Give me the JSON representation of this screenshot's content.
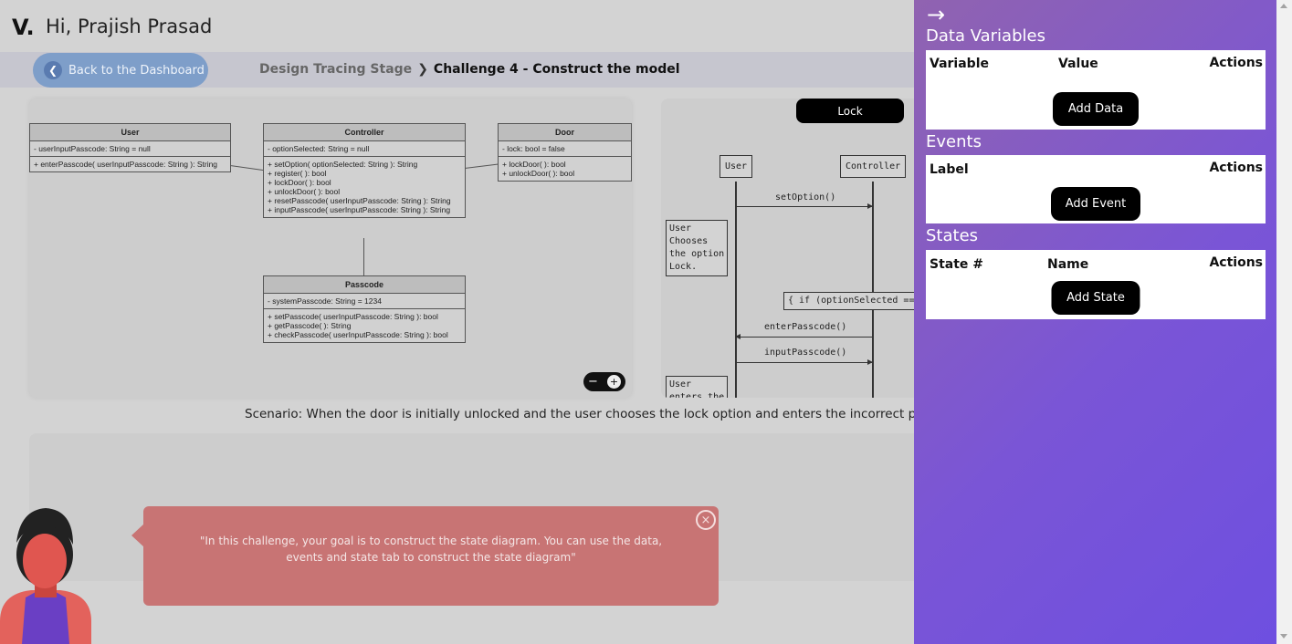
{
  "header": {
    "logo": "V.",
    "greeting": "Hi, Prajish Prasad",
    "back_button": "Back to the Dashboard",
    "breadcrumb_stage": "Design Tracing Stage",
    "breadcrumb_challenge": "Challenge 4 - Construct the model"
  },
  "class_diagram": {
    "user": {
      "name": "User",
      "attributes": [
        "- userInputPasscode: String = null"
      ],
      "methods": [
        "+ enterPasscode( userInputPasscode: String ): String"
      ]
    },
    "controller": {
      "name": "Controller",
      "attributes": [
        "- optionSelected: String = null"
      ],
      "methods": [
        "+ setOption( optionSelected: String ): String",
        "+ register( ): bool",
        "+ lockDoor( ): bool",
        "+ unlockDoor( ): bool",
        "+ resetPasscode( userInputPasscode: String ): String",
        "+ inputPasscode( userInputPasscode: String ): String"
      ]
    },
    "door": {
      "name": "Door",
      "attributes": [
        "- lock: bool = false"
      ],
      "methods": [
        "+ lockDoor( ): bool",
        "+ unlockDoor( ): bool"
      ]
    },
    "passcode": {
      "name": "Passcode",
      "attributes": [
        "- systemPasscode: String = 1234"
      ],
      "methods": [
        "+ setPasscode( userInputPasscode: String ): bool",
        "+ getPasscode( ): String",
        "+ checkPasscode( userInputPasscode: String ): bool"
      ]
    },
    "zoom_out": "−",
    "zoom_in": "+"
  },
  "sequence_diagram": {
    "lock_button": "Lock",
    "lifeline_user": "User",
    "lifeline_controller": "Controller",
    "msg_set_option": "setOption()",
    "note_user_chooses": "User\nChooses\nthe option\nLock.",
    "guard": "{ if (optionSelected == 'lock'",
    "msg_enter_passcode": "enterPasscode()",
    "msg_input_passcode": "inputPasscode()",
    "note_user_enters": "User\nenters the"
  },
  "scenario": "Scenario: When the door is initially unlocked and the user chooses the lock option and enters the incorrect passcode the door remains unlocked.",
  "assistant": {
    "message": "\"In this challenge, your goal is to construct the state diagram. You can use the data, events and state tab to construct the state diagram\"",
    "close": "×"
  },
  "drawer": {
    "arrow": "→",
    "data_variables": {
      "title": "Data Variables",
      "columns": [
        "Variable",
        "Value",
        "Actions"
      ],
      "button": "Add Data"
    },
    "events": {
      "title": "Events",
      "columns": [
        "Label",
        "Actions"
      ],
      "button": "Add Event"
    },
    "states": {
      "title": "States",
      "columns": [
        "State #",
        "Name",
        "Actions"
      ],
      "button": "Add State"
    }
  },
  "colors": {
    "drawer_start": "#9063b0",
    "drawer_end": "#6e4fe0",
    "bubble": "#c87474",
    "back_button": "#7e9ec9"
  }
}
